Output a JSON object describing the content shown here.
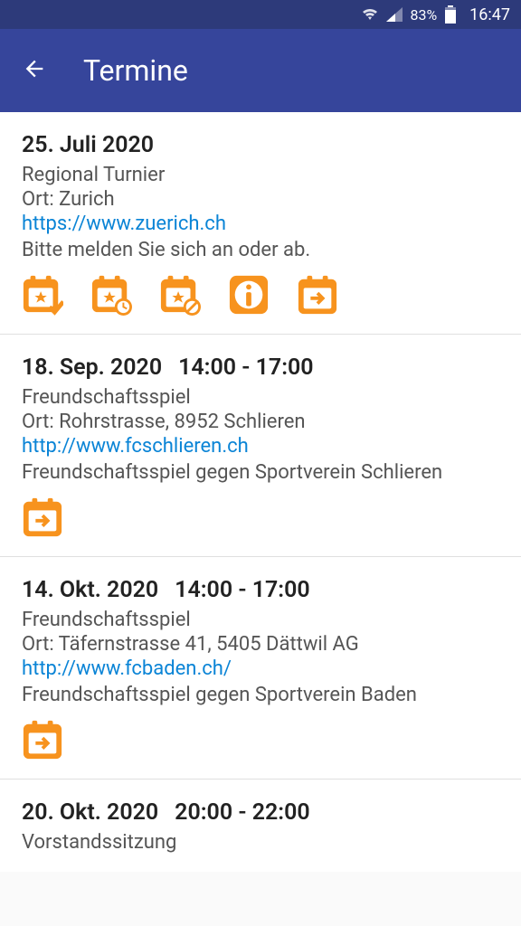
{
  "status": {
    "battery_percent": "83%",
    "time": "16:47"
  },
  "header": {
    "title": "Termine"
  },
  "events": [
    {
      "date": "25. Juli 2020",
      "time": "",
      "title": "Regional Turnier",
      "location": "Ort: Zurich",
      "link": "https://www.zuerich.ch",
      "note": "Bitte melden Sie sich an oder ab.",
      "icons": [
        "calendar-star-check",
        "calendar-star-clock",
        "calendar-star-cancel",
        "info",
        "calendar-export"
      ]
    },
    {
      "date": "18. Sep. 2020",
      "time": "14:00 - 17:00",
      "title": "Freundschaftsspiel",
      "location": "Ort: Rohrstrasse, 8952 Schlieren",
      "link": "http://www.fcschlieren.ch",
      "note": "Freundschaftsspiel gegen Sportverein Schlieren",
      "icons": [
        "calendar-export"
      ]
    },
    {
      "date": "14. Okt. 2020",
      "time": "14:00 - 17:00",
      "title": "Freundschaftsspiel",
      "location": "Ort: Täfernstrasse 41, 5405 Dättwil AG",
      "link": "http://www.fcbaden.ch/",
      "note": "Freundschaftsspiel gegen Sportverein Baden",
      "icons": [
        "calendar-export"
      ]
    },
    {
      "date": "20. Okt. 2020",
      "time": "20:00 - 22:00",
      "title": "Vorstandssitzung",
      "location": "",
      "link": "",
      "note": "",
      "icons": []
    }
  ],
  "colors": {
    "accent": "#F7931E",
    "primary": "#36459b",
    "link": "#0a84d6"
  }
}
